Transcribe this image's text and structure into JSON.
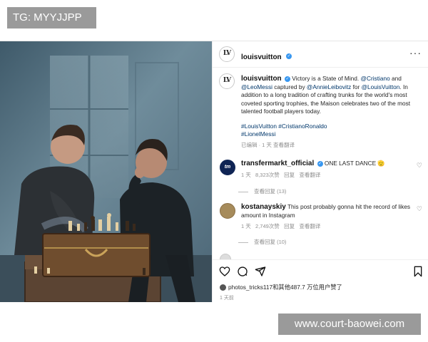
{
  "watermarks": {
    "top": "TG: MYYJJPP",
    "bottom": "www.court-baowei.com"
  },
  "post": {
    "account": "louisvuitton",
    "logo_text": "LV",
    "caption": {
      "username": "louisvuitton",
      "text_1": "Victory is a State of Mind. ",
      "mention_1": "@Cristiano",
      "text_2": " and ",
      "mention_2": "@LeoMessi",
      "text_3": " captured by ",
      "mention_3": "@AnnieLeibovitz",
      "text_4": " for ",
      "mention_4": "@LouisVuitton",
      "text_5": ". In addition to a long tradition of crafting trunks for the world's most coveted sporting trophies, the Maison celebrates two of the most talented football players today.",
      "hashtags_line1": "#LouisVuitton #CristianoRonaldo",
      "hashtags_line2": "#LionelMessi",
      "meta": "已编辑 · 1 天 查看翻译"
    },
    "comments": [
      {
        "username": "transfermarkt_official",
        "avatar_text": "tm",
        "text": "ONE LAST DANCE 🫡",
        "time": "1 天",
        "likes": "8,323次赞",
        "reply": "回复",
        "translate": "查看翻译",
        "view_replies": "查看回复 (13)"
      },
      {
        "username": "kostanayskiy",
        "text": "This post probably gonna hit the record of likes amount in Instagram",
        "time": "1 天",
        "likes": "2,749次赞",
        "reply": "回复",
        "translate": "查看翻译",
        "view_replies": "查看回复 (10)"
      }
    ],
    "liked_by": "photos_tricks117和其他487.7 万位用户赞了",
    "posted": "1 天前"
  },
  "colors": {
    "link": "#00376b",
    "verified": "#3897f0",
    "muted": "#8e8e8e"
  }
}
